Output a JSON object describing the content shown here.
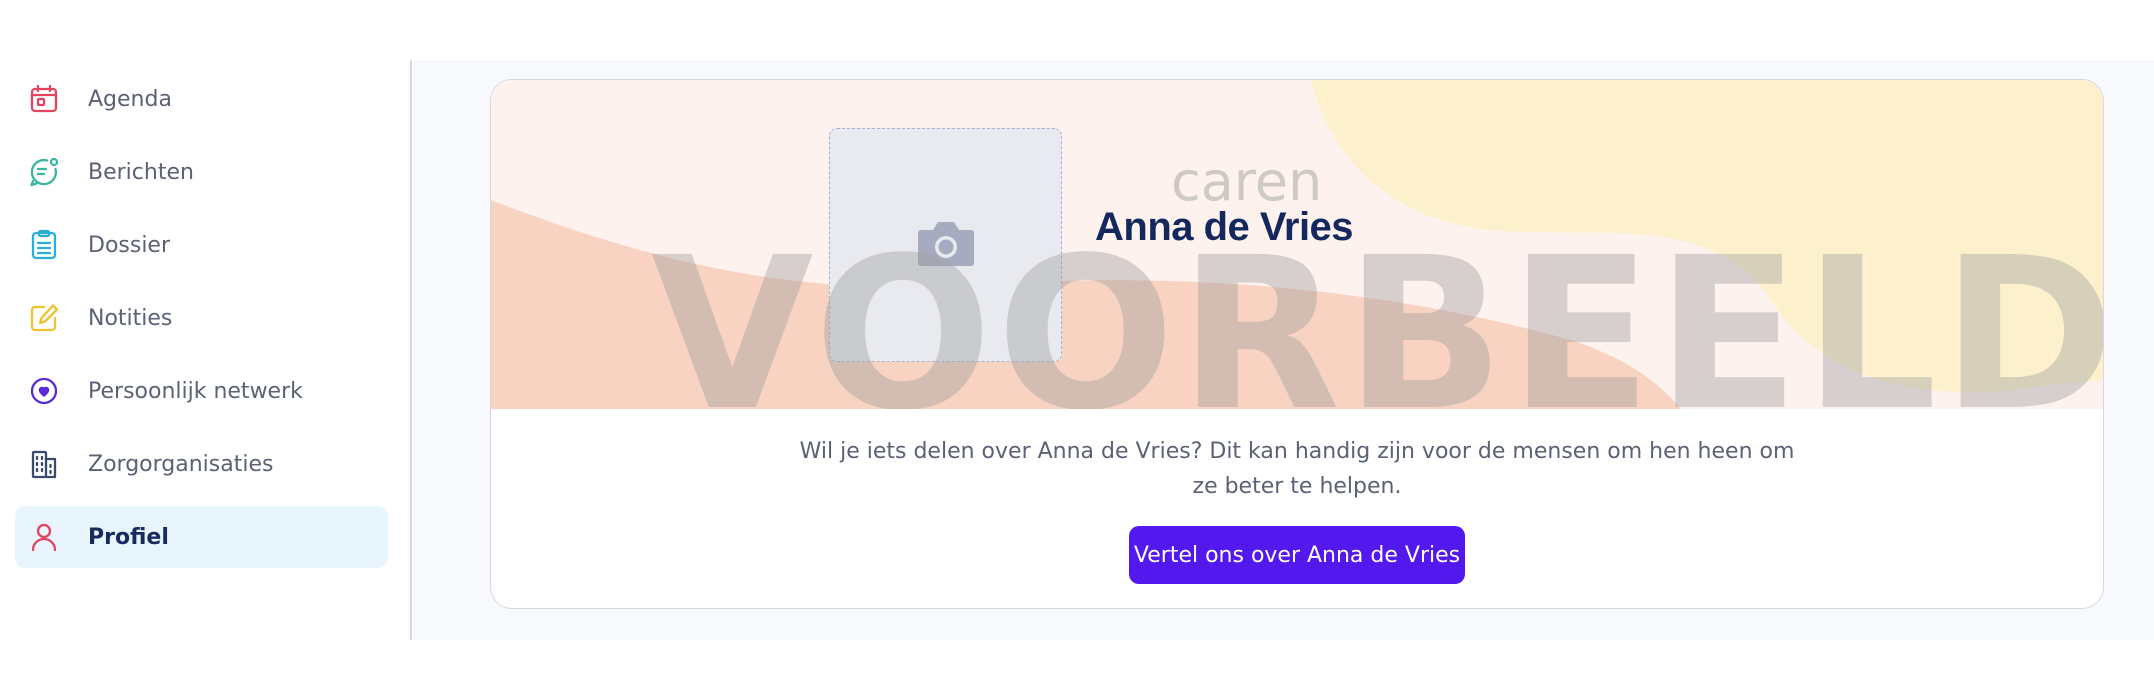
{
  "sidebar": {
    "items": [
      {
        "label": "Agenda",
        "icon": "calendar-icon",
        "color": "#e0445e"
      },
      {
        "label": "Berichten",
        "icon": "chat-icon",
        "color": "#3bb5a0"
      },
      {
        "label": "Dossier",
        "icon": "clipboard-icon",
        "color": "#2aaed8"
      },
      {
        "label": "Notities",
        "icon": "edit-icon",
        "color": "#f2c12e"
      },
      {
        "label": "Persoonlijk netwerk",
        "icon": "heart-location-icon",
        "color": "#5a2bd8"
      },
      {
        "label": "Zorgorganisaties",
        "icon": "building-icon",
        "color": "#3a4a6e"
      },
      {
        "label": "Profiel",
        "icon": "user-icon",
        "color": "#e0445e",
        "active": true
      }
    ]
  },
  "profile": {
    "logo_text": "caren",
    "name": "Anna de Vries",
    "watermark": "VOORBEELD",
    "photo_icon": "camera-icon",
    "description_line1": "Wil je iets delen over Anna de Vries? Dit kan handig zijn voor de mensen om hen heen om",
    "description_line2": "ze beter te helpen.",
    "cta_label": "Vertel ons over Anna de Vries"
  },
  "colors": {
    "accent": "#5318ee",
    "banner_bg": "#fdf2ee",
    "banner_peach": "#f9d3c2",
    "banner_yellow": "#fdf1cd",
    "name_color": "#14285e"
  }
}
